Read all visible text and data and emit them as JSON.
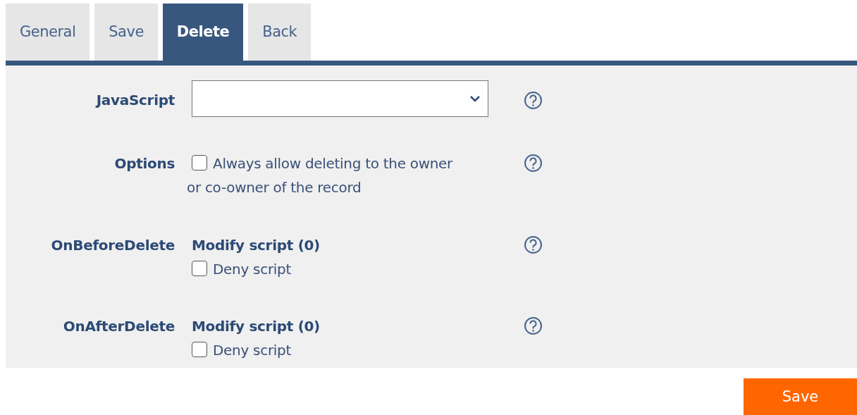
{
  "tabs": [
    {
      "label": "General",
      "selected": false
    },
    {
      "label": "Save",
      "selected": false
    },
    {
      "label": "Delete",
      "selected": true
    },
    {
      "label": "Back",
      "selected": false
    }
  ],
  "fields": [
    {
      "kind": "select",
      "label": "JavaScript"
    },
    {
      "kind": "checkbox",
      "label": "Options",
      "option": {
        "lines": [
          "Always allow deleting to the owner",
          "or co-owner of the record"
        ],
        "checked": false
      }
    },
    {
      "kind": "script",
      "label": "OnBeforeDelete",
      "link": "Modify script (0)",
      "option": {
        "text": "Deny script",
        "checked": false
      }
    },
    {
      "kind": "script",
      "label": "OnAfterDelete",
      "link": "Modify script (0)",
      "option": {
        "text": "Deny script",
        "checked": false
      }
    }
  ],
  "save_button": "Save"
}
